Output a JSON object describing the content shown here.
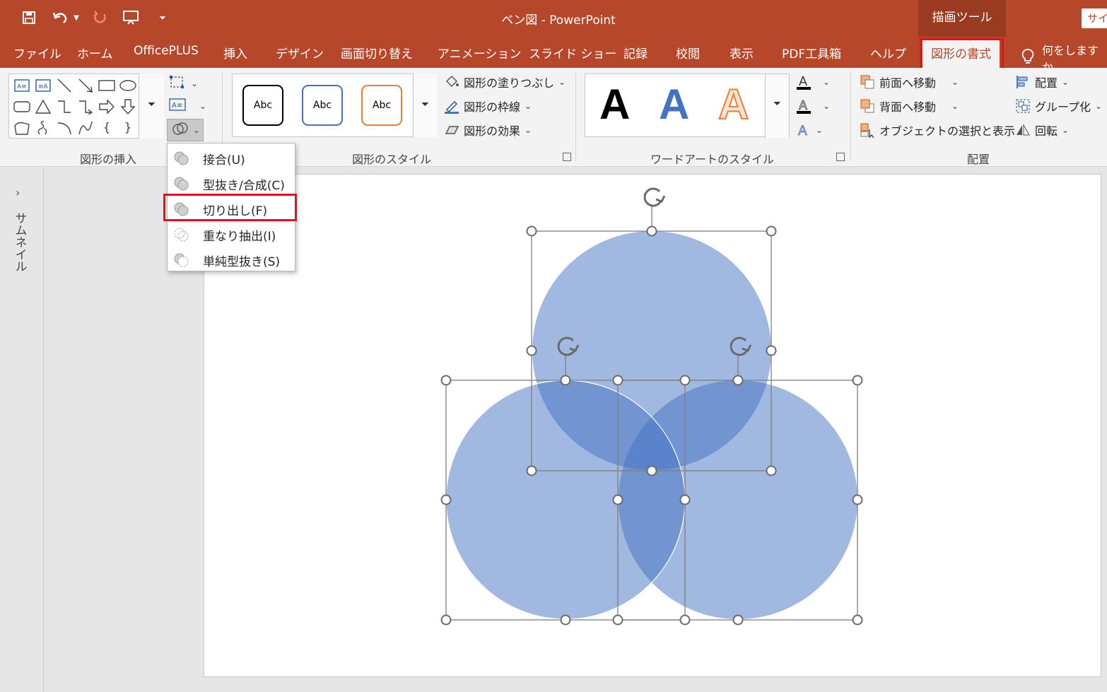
{
  "window": {
    "title": "ベン図  -  PowerPoint",
    "context_tab_group": "描画ツール",
    "signin_label": "サイ"
  },
  "quick_access": {
    "icons": [
      "save-icon",
      "undo-icon",
      "undo-dropdown-icon",
      "redo-icon",
      "present-icon",
      "customize-icon"
    ]
  },
  "tabs": [
    "ファイル",
    "ホーム",
    "OfficePLUS",
    "挿入",
    "デザイン",
    "画面切り替え",
    "アニメーション",
    "スライド ショー",
    "記録",
    "校閲",
    "表示",
    "PDF工具箱",
    "ヘルプ",
    "図形の書式"
  ],
  "active_tab": "図形の書式",
  "tell_me": "何をしますか",
  "ribbon": {
    "insert_shapes": {
      "label": "図形の挿入"
    },
    "shape_styles": {
      "label": "図形のスタイル",
      "presets": [
        "Abc",
        "Abc",
        "Abc"
      ],
      "fill": "図形の塗りつぶし",
      "outline": "図形の枠線",
      "effects": "図形の効果"
    },
    "wordart_styles": {
      "label": "ワードアートのスタイル",
      "presets": [
        "A",
        "A",
        "A"
      ]
    },
    "arrange": {
      "label": "配置",
      "bring_forward": "前面へ移動",
      "send_backward": "背面へ移動",
      "selection_pane": "オブジェクトの選択と表示",
      "align": "配置",
      "group": "グループ化",
      "rotate": "回転"
    }
  },
  "merge_shapes_menu": {
    "items": [
      {
        "label": "接合",
        "key": "(U)"
      },
      {
        "label": "型抜き/合成",
        "key": "(C)"
      },
      {
        "label": "切り出し",
        "key": "(F)"
      },
      {
        "label": "重なり抽出",
        "key": "(I)"
      },
      {
        "label": "単純型抜き",
        "key": "(S)"
      }
    ],
    "highlighted_index": 2
  },
  "thumbnail_pane": {
    "label": "サムネイル"
  },
  "colors": {
    "accent": "#b7472a",
    "context": "#9a3a20",
    "highlight": "#e0121e",
    "circle": "#4472c4"
  }
}
